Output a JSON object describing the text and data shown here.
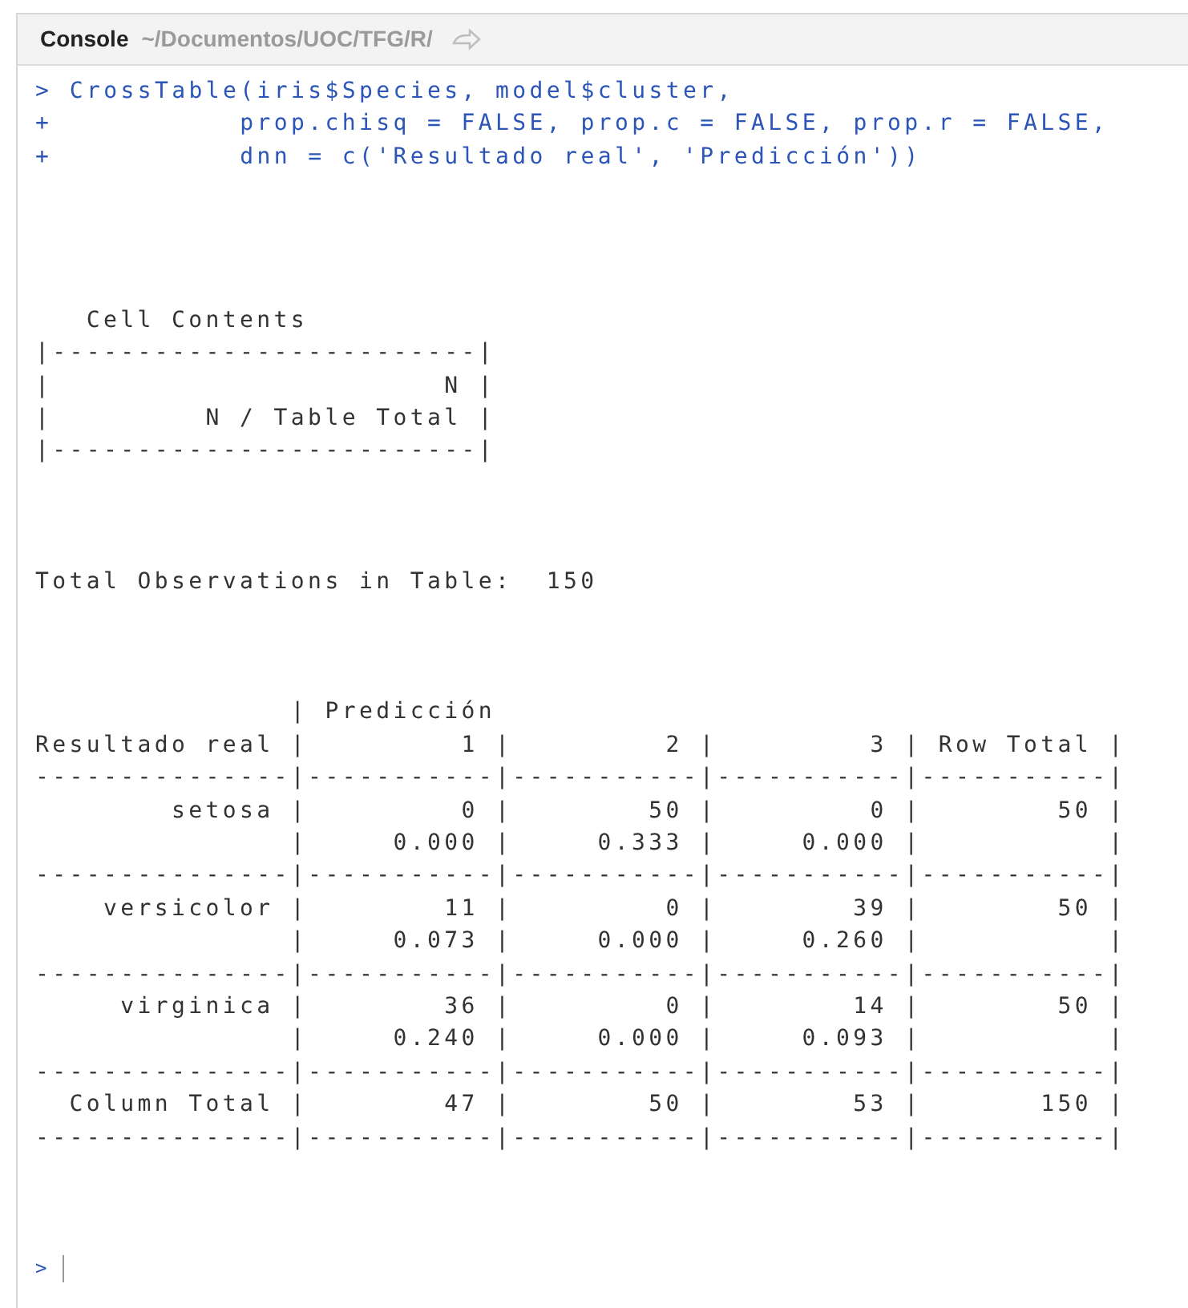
{
  "pane": {
    "title": "Console",
    "path": "~/Documentos/UOC/TFG/R/"
  },
  "console": {
    "lines": [
      {
        "kind": "input",
        "prompt": ">",
        "text": "CrossTable(iris$Species, model$cluster,"
      },
      {
        "kind": "input",
        "prompt": "+",
        "text": "          prop.chisq = FALSE, prop.c = FALSE, prop.r = FALSE,"
      },
      {
        "kind": "input",
        "prompt": "+",
        "text": "          dnn = c('Resultado real', 'Predicción'))"
      },
      {
        "kind": "blank"
      },
      {
        "kind": "blank"
      },
      {
        "kind": "blank"
      },
      {
        "kind": "blank"
      },
      {
        "kind": "output",
        "text": "   Cell Contents"
      },
      {
        "kind": "output",
        "text": "|-------------------------|"
      },
      {
        "kind": "output",
        "text": "|                       N |"
      },
      {
        "kind": "output",
        "text": "|         N / Table Total |"
      },
      {
        "kind": "output",
        "text": "|-------------------------|"
      },
      {
        "kind": "blank"
      },
      {
        "kind": "blank"
      },
      {
        "kind": "blank"
      },
      {
        "kind": "output",
        "text": "Total Observations in Table:  150"
      },
      {
        "kind": "blank"
      },
      {
        "kind": "blank"
      },
      {
        "kind": "blank"
      },
      {
        "kind": "output",
        "text": "               | Predicción"
      },
      {
        "kind": "output",
        "text": "Resultado real |         1 |         2 |         3 | Row Total |"
      },
      {
        "kind": "output",
        "text": "---------------|-----------|-----------|-----------|-----------|"
      },
      {
        "kind": "output",
        "text": "        setosa |         0 |        50 |         0 |        50 |"
      },
      {
        "kind": "output",
        "text": "               |     0.000 |     0.333 |     0.000 |           |"
      },
      {
        "kind": "output",
        "text": "---------------|-----------|-----------|-----------|-----------|"
      },
      {
        "kind": "output",
        "text": "    versicolor |        11 |         0 |        39 |        50 |"
      },
      {
        "kind": "output",
        "text": "               |     0.073 |     0.000 |     0.260 |           |"
      },
      {
        "kind": "output",
        "text": "---------------|-----------|-----------|-----------|-----------|"
      },
      {
        "kind": "output",
        "text": "     virginica |        36 |         0 |        14 |        50 |"
      },
      {
        "kind": "output",
        "text": "               |     0.240 |     0.000 |     0.093 |           |"
      },
      {
        "kind": "output",
        "text": "---------------|-----------|-----------|-----------|-----------|"
      },
      {
        "kind": "output",
        "text": "  Column Total |        47 |        50 |        53 |       150 |"
      },
      {
        "kind": "output",
        "text": "---------------|-----------|-----------|-----------|-----------|"
      },
      {
        "kind": "blank"
      },
      {
        "kind": "blank"
      },
      {
        "kind": "blank"
      }
    ],
    "prompt": ">"
  }
}
